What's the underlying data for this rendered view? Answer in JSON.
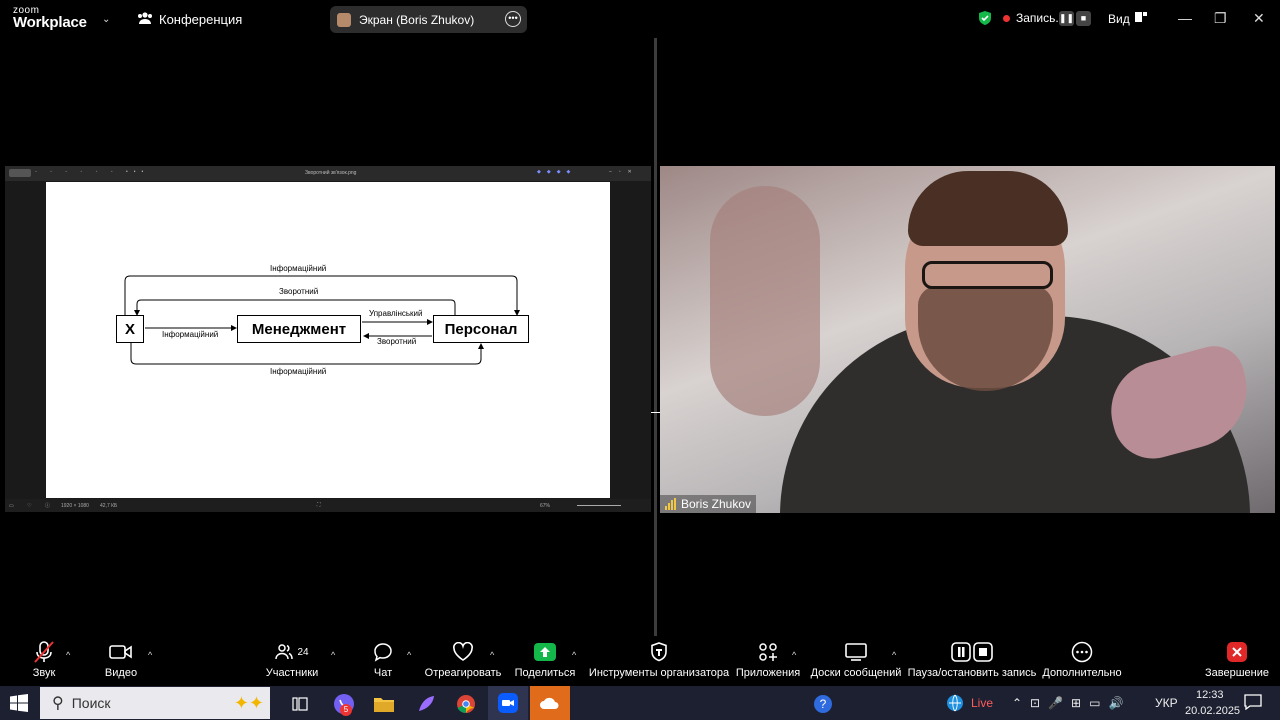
{
  "app": {
    "brand_top": "zoom",
    "brand_bottom": "Workplace"
  },
  "meeting": {
    "title": "Конференция"
  },
  "screen_share": {
    "label": "Экран (Boris Zhukov)"
  },
  "recording": {
    "label": "Запись...",
    "pause_symbol": "❚❚",
    "stop_symbol": "■"
  },
  "view": {
    "label": "Вид"
  },
  "window_controls": {
    "minimize": "—",
    "restore": "❐",
    "close": "✕"
  },
  "viewer": {
    "filename": "Зворотний зв'язок.png",
    "zoom": "67%",
    "dimensions": "1920 × 1080",
    "filesize": "42,7 КБ"
  },
  "diagram": {
    "nodes": {
      "x": "X",
      "management": "Менеджмент",
      "staff": "Персонал"
    },
    "edges": {
      "info_top": "Інформаційний",
      "feedback_top": "Зворотний",
      "info_left": "Інформаційний",
      "control": "Управлінський",
      "feedback_mid": "Зворотний",
      "info_bottom": "Інформаційний"
    }
  },
  "video": {
    "participant_name": "Boris Zhukov"
  },
  "toolbar": {
    "audio": "Звук",
    "video": "Видео",
    "participants": "Участники",
    "participants_count": "24",
    "chat": "Чат",
    "react": "Отреагировать",
    "share": "Поделиться",
    "host_tools": "Инструменты организатора",
    "apps": "Приложения",
    "whiteboards": "Доски сообщений",
    "pause_stop_recording": "Пауза/остановить запись",
    "more": "Дополнительно",
    "end": "Завершение"
  },
  "taskbar": {
    "search_placeholder": "Поиск",
    "viber_badge": "5",
    "live": "Live",
    "language": "УКР",
    "time": "12:33",
    "date": "20.02.2025"
  },
  "colors": {
    "accent_green": "#14b74a",
    "record_red": "#e33333",
    "end_red": "#e02828",
    "signal_yellow": "#f2c744"
  }
}
